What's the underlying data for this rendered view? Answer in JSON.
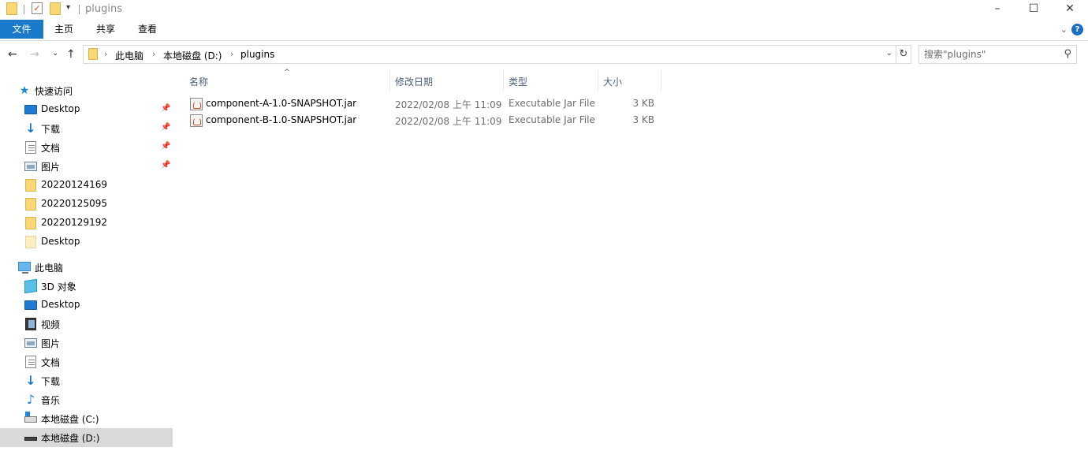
{
  "window": {
    "title": "plugins",
    "controls": {
      "minimize": "–",
      "maximize": "☐",
      "close": "✕"
    }
  },
  "ribbon": {
    "tabs": [
      {
        "label": "文件",
        "active": true
      },
      {
        "label": "主页"
      },
      {
        "label": "共享"
      },
      {
        "label": "查看"
      }
    ],
    "help": "?"
  },
  "address": {
    "breadcrumb": [
      "此电脑",
      "本地磁盘 (D:)",
      "plugins"
    ]
  },
  "search": {
    "placeholder": "搜索\"plugins\""
  },
  "nav": {
    "quick_access": "快速访问",
    "quick_items": [
      {
        "label": "Desktop",
        "icon": "desktop-icon",
        "pinned": true
      },
      {
        "label": "下载",
        "icon": "download-icon",
        "pinned": true
      },
      {
        "label": "文档",
        "icon": "document-icon",
        "pinned": true
      },
      {
        "label": "图片",
        "icon": "picture-icon",
        "pinned": true
      },
      {
        "label": "20220124169",
        "icon": "folder-icon"
      },
      {
        "label": "20220125095",
        "icon": "folder-icon"
      },
      {
        "label": "20220129192",
        "icon": "folder-icon"
      },
      {
        "label": "Desktop",
        "icon": "folder-icon"
      }
    ],
    "this_pc": "此电脑",
    "pc_items": [
      {
        "label": "3D 对象",
        "icon": "3d-objects-icon"
      },
      {
        "label": "Desktop",
        "icon": "desktop-icon"
      },
      {
        "label": "视频",
        "icon": "video-icon"
      },
      {
        "label": "图片",
        "icon": "picture-icon"
      },
      {
        "label": "文档",
        "icon": "document-icon"
      },
      {
        "label": "下载",
        "icon": "download-icon"
      },
      {
        "label": "音乐",
        "icon": "music-icon"
      },
      {
        "label": "本地磁盘 (C:)",
        "icon": "drive-c-icon"
      },
      {
        "label": "本地磁盘 (D:)",
        "icon": "drive-d-icon",
        "selected": true
      }
    ]
  },
  "files": {
    "columns": [
      "名称",
      "修改日期",
      "类型",
      "大小"
    ],
    "sort_indicator": "^",
    "rows": [
      {
        "name": "component-A-1.0-SNAPSHOT.jar",
        "modified": "2022/02/08 上午 11:09",
        "type": "Executable Jar File",
        "size": "3 KB"
      },
      {
        "name": "component-B-1.0-SNAPSHOT.jar",
        "modified": "2022/02/08 上午 11:09",
        "type": "Executable Jar File",
        "size": "3 KB"
      }
    ]
  },
  "colors": {
    "file_tab": "#1979ca",
    "header_text": "#4c607a",
    "selected_nav": "#d9d9d9"
  }
}
